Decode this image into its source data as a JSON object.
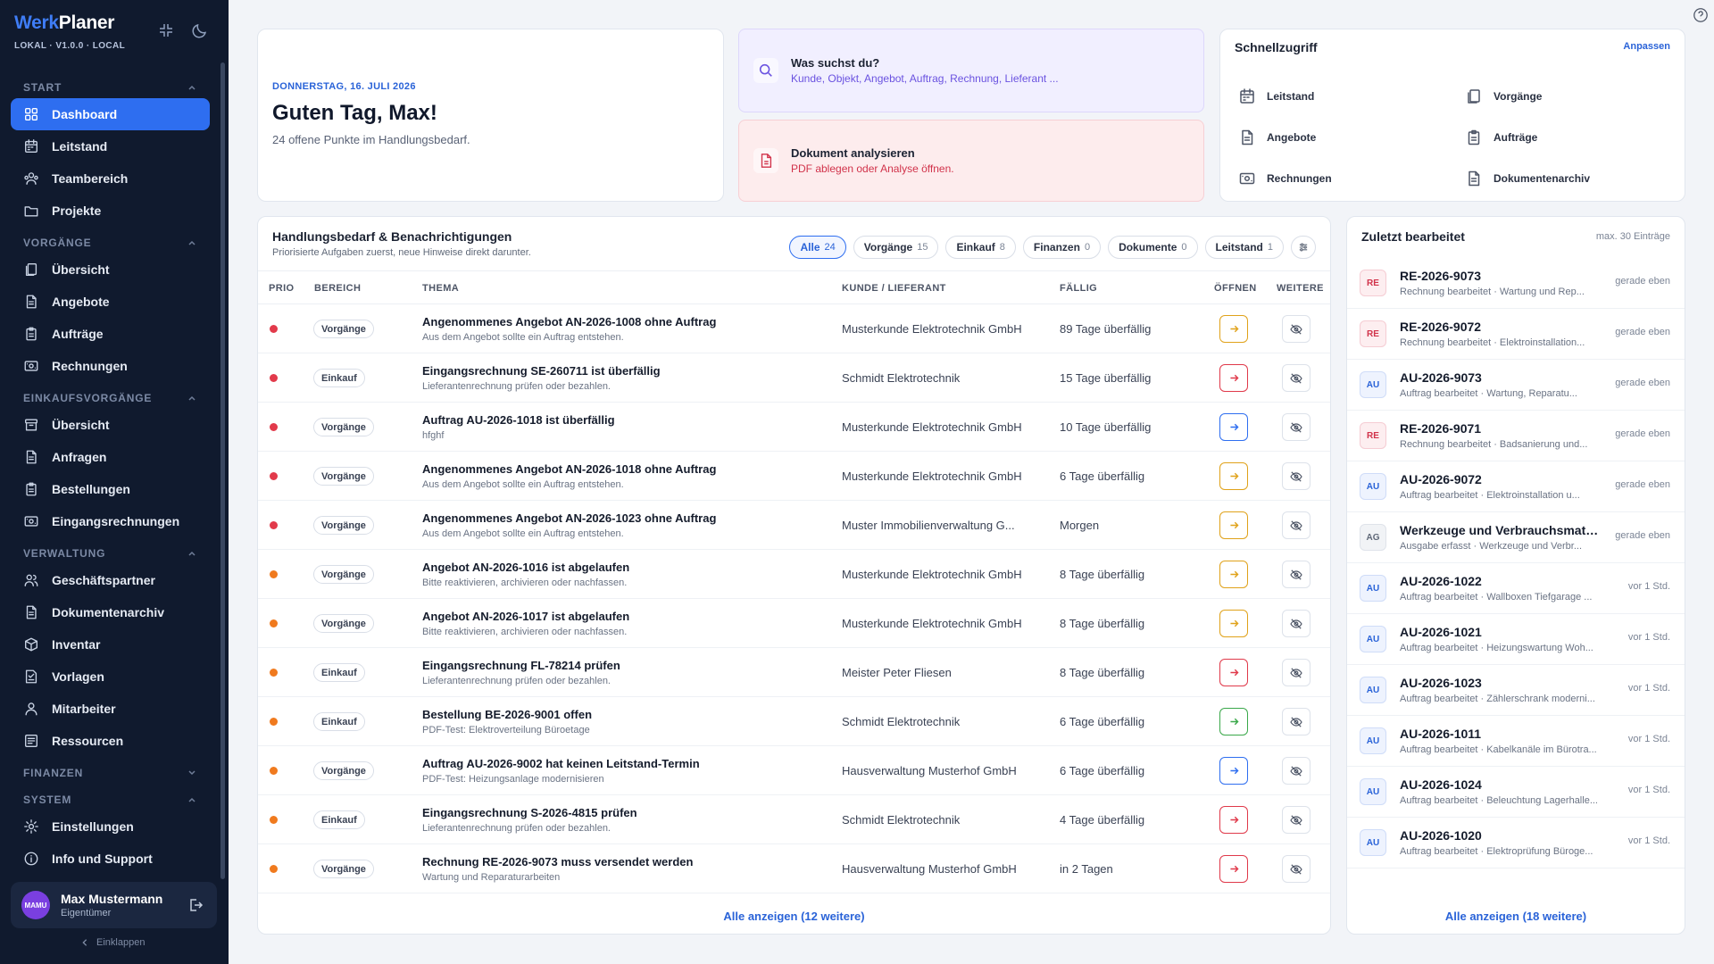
{
  "app": {
    "brand_a": "Werk",
    "brand_b": "Planer",
    "version": "LOKAL · V1.0.0 · LOCAL"
  },
  "sidebar": {
    "sections": [
      {
        "title": "START",
        "items": [
          {
            "label": "Dashboard",
            "icon": "grid-icon",
            "active": true
          },
          {
            "label": "Leitstand",
            "icon": "calendar-icon"
          },
          {
            "label": "Teambereich",
            "icon": "team-icon"
          },
          {
            "label": "Projekte",
            "icon": "folder-icon"
          }
        ]
      },
      {
        "title": "VORGÄNGE",
        "items": [
          {
            "label": "Übersicht",
            "icon": "copy-icon"
          },
          {
            "label": "Angebote",
            "icon": "document-icon"
          },
          {
            "label": "Aufträge",
            "icon": "clipboard-icon"
          },
          {
            "label": "Rechnungen",
            "icon": "bill-icon"
          }
        ]
      },
      {
        "title": "EINKAUFSVORGÄNGE",
        "items": [
          {
            "label": "Übersicht",
            "icon": "archive-icon"
          },
          {
            "label": "Anfragen",
            "icon": "document-icon"
          },
          {
            "label": "Bestellungen",
            "icon": "clipboard-icon"
          },
          {
            "label": "Eingangsrechnungen",
            "icon": "bill-icon"
          }
        ]
      },
      {
        "title": "VERWALTUNG",
        "items": [
          {
            "label": "Geschäftspartner",
            "icon": "partners-icon"
          },
          {
            "label": "Dokumentenarchiv",
            "icon": "document-icon"
          },
          {
            "label": "Inventar",
            "icon": "box-icon"
          },
          {
            "label": "Vorlagen",
            "icon": "template-icon"
          },
          {
            "label": "Mitarbeiter",
            "icon": "user-icon"
          },
          {
            "label": "Ressourcen",
            "icon": "resources-icon"
          }
        ]
      },
      {
        "title": "FINANZEN",
        "items": []
      },
      {
        "title": "SYSTEM",
        "items": [
          {
            "label": "Einstellungen",
            "icon": "gear-icon"
          },
          {
            "label": "Info und Support",
            "icon": "info-icon"
          }
        ]
      }
    ],
    "user": {
      "initials": "MAMU",
      "name": "Max Mustermann",
      "role": "Eigentümer"
    },
    "collapse_label": "Einklappen"
  },
  "greeting": {
    "date": "DONNERSTAG, 16. JULI 2026",
    "title": "Guten Tag, Max!",
    "subtitle": "24 offene Punkte im Handlungsbedarf."
  },
  "search_card": {
    "title": "Was suchst du?",
    "subtitle": "Kunde, Objekt, Angebot, Auftrag, Rechnung, Lieferant ..."
  },
  "analyze_card": {
    "title": "Dokument analysieren",
    "subtitle": "PDF ablegen oder Analyse öffnen."
  },
  "quick": {
    "title": "Schnellzugriff",
    "customize": "Anpassen",
    "items": [
      "Leitstand",
      "Vorgänge",
      "Angebote",
      "Aufträge",
      "Rechnungen",
      "Dokumentenarchiv"
    ]
  },
  "tasks": {
    "title": "Handlungsbedarf & Benachrichtigungen",
    "subtitle": "Priorisierte Aufgaben zuerst, neue Hinweise direkt darunter.",
    "filters": [
      {
        "label": "Alle",
        "count": "24",
        "active": true
      },
      {
        "label": "Vorgänge",
        "count": "15"
      },
      {
        "label": "Einkauf",
        "count": "8"
      },
      {
        "label": "Finanzen",
        "count": "0"
      },
      {
        "label": "Dokumente",
        "count": "0"
      },
      {
        "label": "Leitstand",
        "count": "1"
      }
    ],
    "columns": [
      "PRIO",
      "BEREICH",
      "THEMA",
      "KUNDE / LIEFERANT",
      "FÄLLIG",
      "ÖFFNEN",
      "WEITERE"
    ],
    "rows": [
      {
        "prio": "#e23a4b",
        "area": "Vorgänge",
        "topic": "Angenommenes Angebot AN-2026-1008 ohne Auftrag",
        "detail": "Aus dem Angebot sollte ein Auftrag entstehen.",
        "customer": "Musterkunde Elektrotechnik GmbH",
        "due": "89 Tage überfällig",
        "open_color": "#e0a21a"
      },
      {
        "prio": "#e23a4b",
        "area": "Einkauf",
        "topic": "Eingangsrechnung SE-260711 ist überfällig",
        "detail": "Lieferantenrechnung prüfen oder bezahlen.",
        "customer": "Schmidt Elektrotechnik",
        "due": "15 Tage überfällig",
        "open_color": "#e0394a"
      },
      {
        "prio": "#e23a4b",
        "area": "Vorgänge",
        "topic": "Auftrag AU-2026-1018 ist überfällig",
        "detail": "hfghf",
        "customer": "Musterkunde Elektrotechnik GmbH",
        "due": "10 Tage überfällig",
        "open_color": "#2e6ef0"
      },
      {
        "prio": "#e23a4b",
        "area": "Vorgänge",
        "topic": "Angenommenes Angebot AN-2026-1018 ohne Auftrag",
        "detail": "Aus dem Angebot sollte ein Auftrag entstehen.",
        "customer": "Musterkunde Elektrotechnik GmbH",
        "due": "6 Tage überfällig",
        "open_color": "#e0a21a"
      },
      {
        "prio": "#e23a4b",
        "area": "Vorgänge",
        "topic": "Angenommenes Angebot AN-2026-1023 ohne Auftrag",
        "detail": "Aus dem Angebot sollte ein Auftrag entstehen.",
        "customer": "Muster Immobilienverwaltung G...",
        "due": "Morgen",
        "open_color": "#e0a21a"
      },
      {
        "prio": "#f07a1e",
        "area": "Vorgänge",
        "topic": "Angebot AN-2026-1016 ist abgelaufen",
        "detail": "Bitte reaktivieren, archivieren oder nachfassen.",
        "customer": "Musterkunde Elektrotechnik GmbH",
        "due": "8 Tage überfällig",
        "open_color": "#e0a21a"
      },
      {
        "prio": "#f07a1e",
        "area": "Vorgänge",
        "topic": "Angebot AN-2026-1017 ist abgelaufen",
        "detail": "Bitte reaktivieren, archivieren oder nachfassen.",
        "customer": "Musterkunde Elektrotechnik GmbH",
        "due": "8 Tage überfällig",
        "open_color": "#e0a21a"
      },
      {
        "prio": "#f07a1e",
        "area": "Einkauf",
        "topic": "Eingangsrechnung FL-78214 prüfen",
        "detail": "Lieferantenrechnung prüfen oder bezahlen.",
        "customer": "Meister Peter Fliesen",
        "due": "8 Tage überfällig",
        "open_color": "#e0394a"
      },
      {
        "prio": "#f07a1e",
        "area": "Einkauf",
        "topic": "Bestellung BE-2026-9001 offen",
        "detail": "PDF-Test: Elektroverteilung Büroetage",
        "customer": "Schmidt Elektrotechnik",
        "due": "6 Tage überfällig",
        "open_color": "#3aa84a"
      },
      {
        "prio": "#f07a1e",
        "area": "Vorgänge",
        "topic": "Auftrag AU-2026-9002 hat keinen Leitstand-Termin",
        "detail": "PDF-Test: Heizungsanlage modernisieren",
        "customer": "Hausverwaltung Musterhof GmbH",
        "due": "6 Tage überfällig",
        "open_color": "#2e6ef0"
      },
      {
        "prio": "#f07a1e",
        "area": "Einkauf",
        "topic": "Eingangsrechnung S-2026-4815 prüfen",
        "detail": "Lieferantenrechnung prüfen oder bezahlen.",
        "customer": "Schmidt Elektrotechnik",
        "due": "4 Tage überfällig",
        "open_color": "#e0394a"
      },
      {
        "prio": "#f07a1e",
        "area": "Vorgänge",
        "topic": "Rechnung RE-2026-9073 muss versendet werden",
        "detail": "Wartung und Reparaturarbeiten",
        "customer": "Hausverwaltung Musterhof GmbH",
        "due": "in 2 Tagen",
        "open_color": "#e0394a"
      }
    ],
    "show_all": "Alle anzeigen (12 weitere)"
  },
  "recent": {
    "title": "Zuletzt bearbeitet",
    "max": "max. 30 Einträge",
    "items": [
      {
        "badge": "RE",
        "title": "RE-2026-9073",
        "sub": "Rechnung bearbeitet · Wartung und Rep...",
        "time": "gerade eben"
      },
      {
        "badge": "RE",
        "title": "RE-2026-9072",
        "sub": "Rechnung bearbeitet · Elektroinstallation...",
        "time": "gerade eben"
      },
      {
        "badge": "AU",
        "title": "AU-2026-9073",
        "sub": "Auftrag bearbeitet · Wartung, Reparatu...",
        "time": "gerade eben"
      },
      {
        "badge": "RE",
        "title": "RE-2026-9071",
        "sub": "Rechnung bearbeitet · Badsanierung und...",
        "time": "gerade eben"
      },
      {
        "badge": "AU",
        "title": "AU-2026-9072",
        "sub": "Auftrag bearbeitet · Elektroinstallation u...",
        "time": "gerade eben"
      },
      {
        "badge": "AG",
        "title": "Werkzeuge und Verbrauchsmater...",
        "sub": "Ausgabe erfasst · Werkzeuge und Verbr...",
        "time": "gerade eben"
      },
      {
        "badge": "AU",
        "title": "AU-2026-1022",
        "sub": "Auftrag bearbeitet · Wallboxen Tiefgarage ...",
        "time": "vor 1 Std."
      },
      {
        "badge": "AU",
        "title": "AU-2026-1021",
        "sub": "Auftrag bearbeitet · Heizungswartung Woh...",
        "time": "vor 1 Std."
      },
      {
        "badge": "AU",
        "title": "AU-2026-1023",
        "sub": "Auftrag bearbeitet · Zählerschrank moderni...",
        "time": "vor 1 Std."
      },
      {
        "badge": "AU",
        "title": "AU-2026-1011",
        "sub": "Auftrag bearbeitet · Kabelkanäle im Bürotra...",
        "time": "vor 1 Std."
      },
      {
        "badge": "AU",
        "title": "AU-2026-1024",
        "sub": "Auftrag bearbeitet · Beleuchtung Lagerhalle...",
        "time": "vor 1 Std."
      },
      {
        "badge": "AU",
        "title": "AU-2026-1020",
        "sub": "Auftrag bearbeitet · Elektroprüfung Büroge...",
        "time": "vor 1 Std."
      }
    ],
    "show_all": "Alle anzeigen (18 weitere)"
  }
}
